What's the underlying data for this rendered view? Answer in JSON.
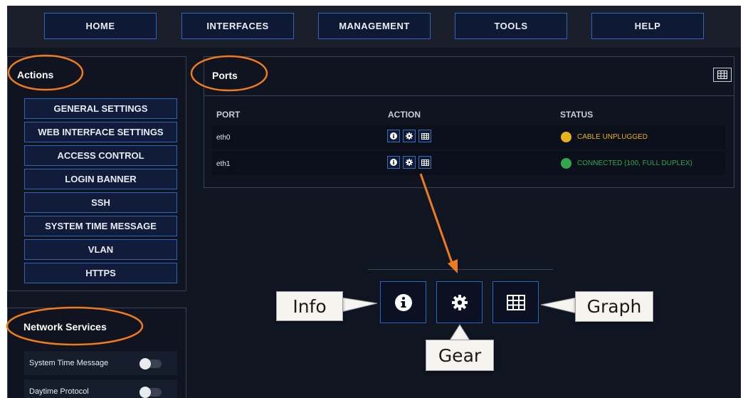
{
  "nav": {
    "items": [
      {
        "label": "HOME"
      },
      {
        "label": "INTERFACES"
      },
      {
        "label": "MANAGEMENT"
      },
      {
        "label": "TOOLS"
      },
      {
        "label": "HELP"
      }
    ]
  },
  "actions": {
    "title": "Actions",
    "items": [
      {
        "label": "GENERAL SETTINGS"
      },
      {
        "label": "WEB INTERFACE SETTINGS"
      },
      {
        "label": "ACCESS CONTROL"
      },
      {
        "label": "LOGIN BANNER"
      },
      {
        "label": "SSH"
      },
      {
        "label": "SYSTEM TIME MESSAGE"
      },
      {
        "label": "VLAN"
      },
      {
        "label": "HTTPS"
      }
    ]
  },
  "network_services": {
    "title": "Network Services",
    "items": [
      {
        "label": "System Time Message",
        "enabled": false
      },
      {
        "label": "Daytime Protocol",
        "enabled": false
      }
    ]
  },
  "ports": {
    "title": "Ports",
    "columns": {
      "port": "PORT",
      "action": "ACTION",
      "status": "STATUS"
    },
    "rows": [
      {
        "port": "eth0",
        "status": "CABLE UNPLUGGED",
        "status_color": "#e8b21a"
      },
      {
        "port": "eth1",
        "status": "CONNECTED (100, FULL DUPLEX)",
        "status_color": "#2fa84f"
      }
    ]
  },
  "callouts": {
    "info": "Info",
    "gear": "Gear",
    "graph": "Graph"
  },
  "colors": {
    "accent_blue": "#2f64b8",
    "annotation_orange": "#f07b1c",
    "background": "#101522"
  },
  "icons": {
    "info": "info-icon",
    "gear": "gear-icon",
    "graph": "grid-icon"
  }
}
